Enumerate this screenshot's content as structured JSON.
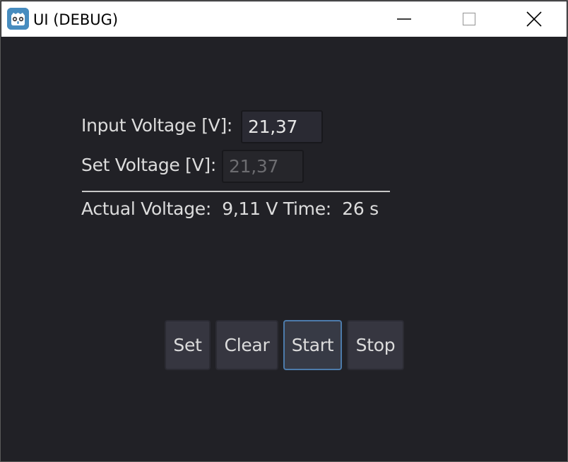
{
  "window": {
    "title": "UI (DEBUG)",
    "app_icon": "godot-icon"
  },
  "form": {
    "input_voltage_label": "Input Voltage [V]:",
    "input_voltage_value": "21,37",
    "set_voltage_label": "Set Voltage [V]:",
    "set_voltage_value": "21,37",
    "status_line": "Actual Voltage:  9,11 V Time:  26 s"
  },
  "buttons": {
    "set": "Set",
    "clear": "Clear",
    "start": "Start",
    "stop": "Stop"
  },
  "colors": {
    "background": "#212126",
    "button": "#363640",
    "focus_border": "#4d7bab",
    "text": "#dcdcdc",
    "titlebar": "#ffffff",
    "icon": "#478cbf"
  }
}
